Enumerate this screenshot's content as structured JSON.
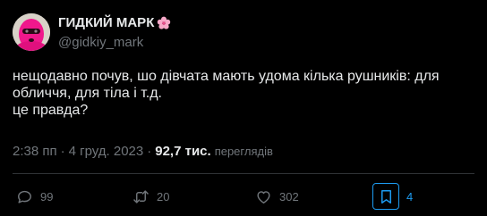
{
  "author": {
    "name": "ГИДКИЙ МАРК",
    "handle": "@gidkiy_mark",
    "avatar_icon": "pink-balaclava-avatar",
    "badge_icon": "sakura-flower-icon"
  },
  "tweet": {
    "lines": [
      "нещодавно почув, шо дівчата мають удома кілька рушників: для",
      "обличчя, для тіла і т.д.",
      "це правда?"
    ]
  },
  "meta": {
    "time": "2:38 пп",
    "separator": "·",
    "date": "4 груд. 2023",
    "views_count": "92,7 тис.",
    "views_label": "переглядів"
  },
  "actions": {
    "replies": "99",
    "retweets": "20",
    "likes": "302",
    "bookmarks": "4"
  },
  "colors": {
    "background": "#000000",
    "text": "#e7e9ea",
    "muted": "#71767b",
    "accent": "#1d9bf0",
    "avatar_pink": "#f0188c"
  }
}
